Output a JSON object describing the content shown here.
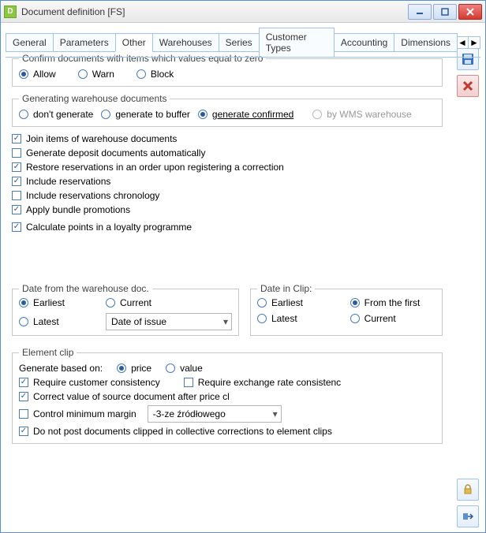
{
  "window": {
    "title": "Document definition [FS]",
    "app_icon_letter": "D"
  },
  "tabs": [
    "General",
    "Parameters",
    "Other",
    "Warehouses",
    "Series",
    "Customer Types",
    "Accounting",
    "Dimensions"
  ],
  "active_tab": 2,
  "confirm_group": {
    "legend": "Confirm documents with items which values equal to zero",
    "options": {
      "allow": "Allow",
      "warn": "Warn",
      "block": "Block"
    }
  },
  "gen_wh_group": {
    "legend": "Generating warehouse documents",
    "options": {
      "dont": "don't generate",
      "buffer": "generate to buffer",
      "confirmed": "generate confirmed",
      "wms": "by WMS warehouse"
    }
  },
  "checks": {
    "join": "Join items of warehouse documents",
    "deposit": "Generate deposit documents automatically",
    "restore": "Restore reservations in an order upon registering a correction",
    "include_res": "Include reservations",
    "include_chron": "Include reservations chronology",
    "bundle": "Apply bundle promotions",
    "loyalty": "Calculate points in a loyalty programme"
  },
  "date_wh": {
    "legend": "Date from the warehouse doc.",
    "earliest": "Earliest",
    "latest": "Latest",
    "current": "Current",
    "dropdown": "Date of issue"
  },
  "date_clip": {
    "legend": "Date in Clip:",
    "earliest": "Earliest",
    "latest": "Latest",
    "from_first": "From the first",
    "current": "Current"
  },
  "element_clip": {
    "legend": "Element clip",
    "gen_label": "Generate based on:",
    "price": "price",
    "value": "value",
    "req_customer": "Require customer consistency",
    "req_exchange": "Require exchange rate consistenc",
    "correct_value": "Correct value of source document after price cl",
    "control_margin": "Control minimum margin",
    "margin_dropdown": "-3-ze źródłowego",
    "no_post": "Do not post documents clipped in collective corrections to element clips"
  }
}
